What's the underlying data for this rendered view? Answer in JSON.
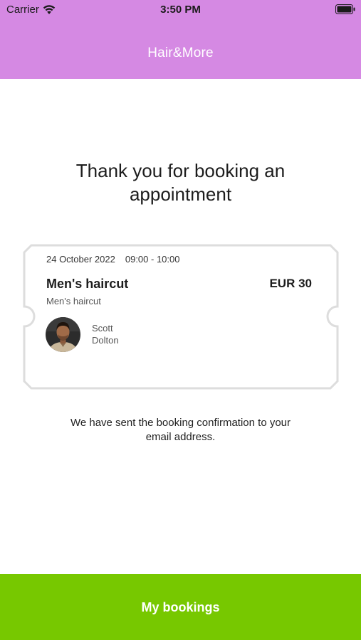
{
  "status_bar": {
    "carrier": "Carrier",
    "time": "3:50 PM",
    "wifi_icon": "wifi-icon",
    "battery_icon": "battery-full-icon"
  },
  "nav": {
    "title": "Hair&More",
    "background_color": "#d589e3"
  },
  "heading": "Thank you for booking an appointment",
  "booking": {
    "date": "24 October 2022",
    "time": "09:00 - 10:00",
    "service": "Men's haircut",
    "service_subtitle": "Men's haircut",
    "price": "EUR 30",
    "staff": {
      "first_name": "Scott",
      "last_name": "Dolton"
    }
  },
  "confirmation_text": "We have sent the booking confirmation to your email address.",
  "bottom_button": {
    "label": "My bookings",
    "color": "#77c800"
  }
}
